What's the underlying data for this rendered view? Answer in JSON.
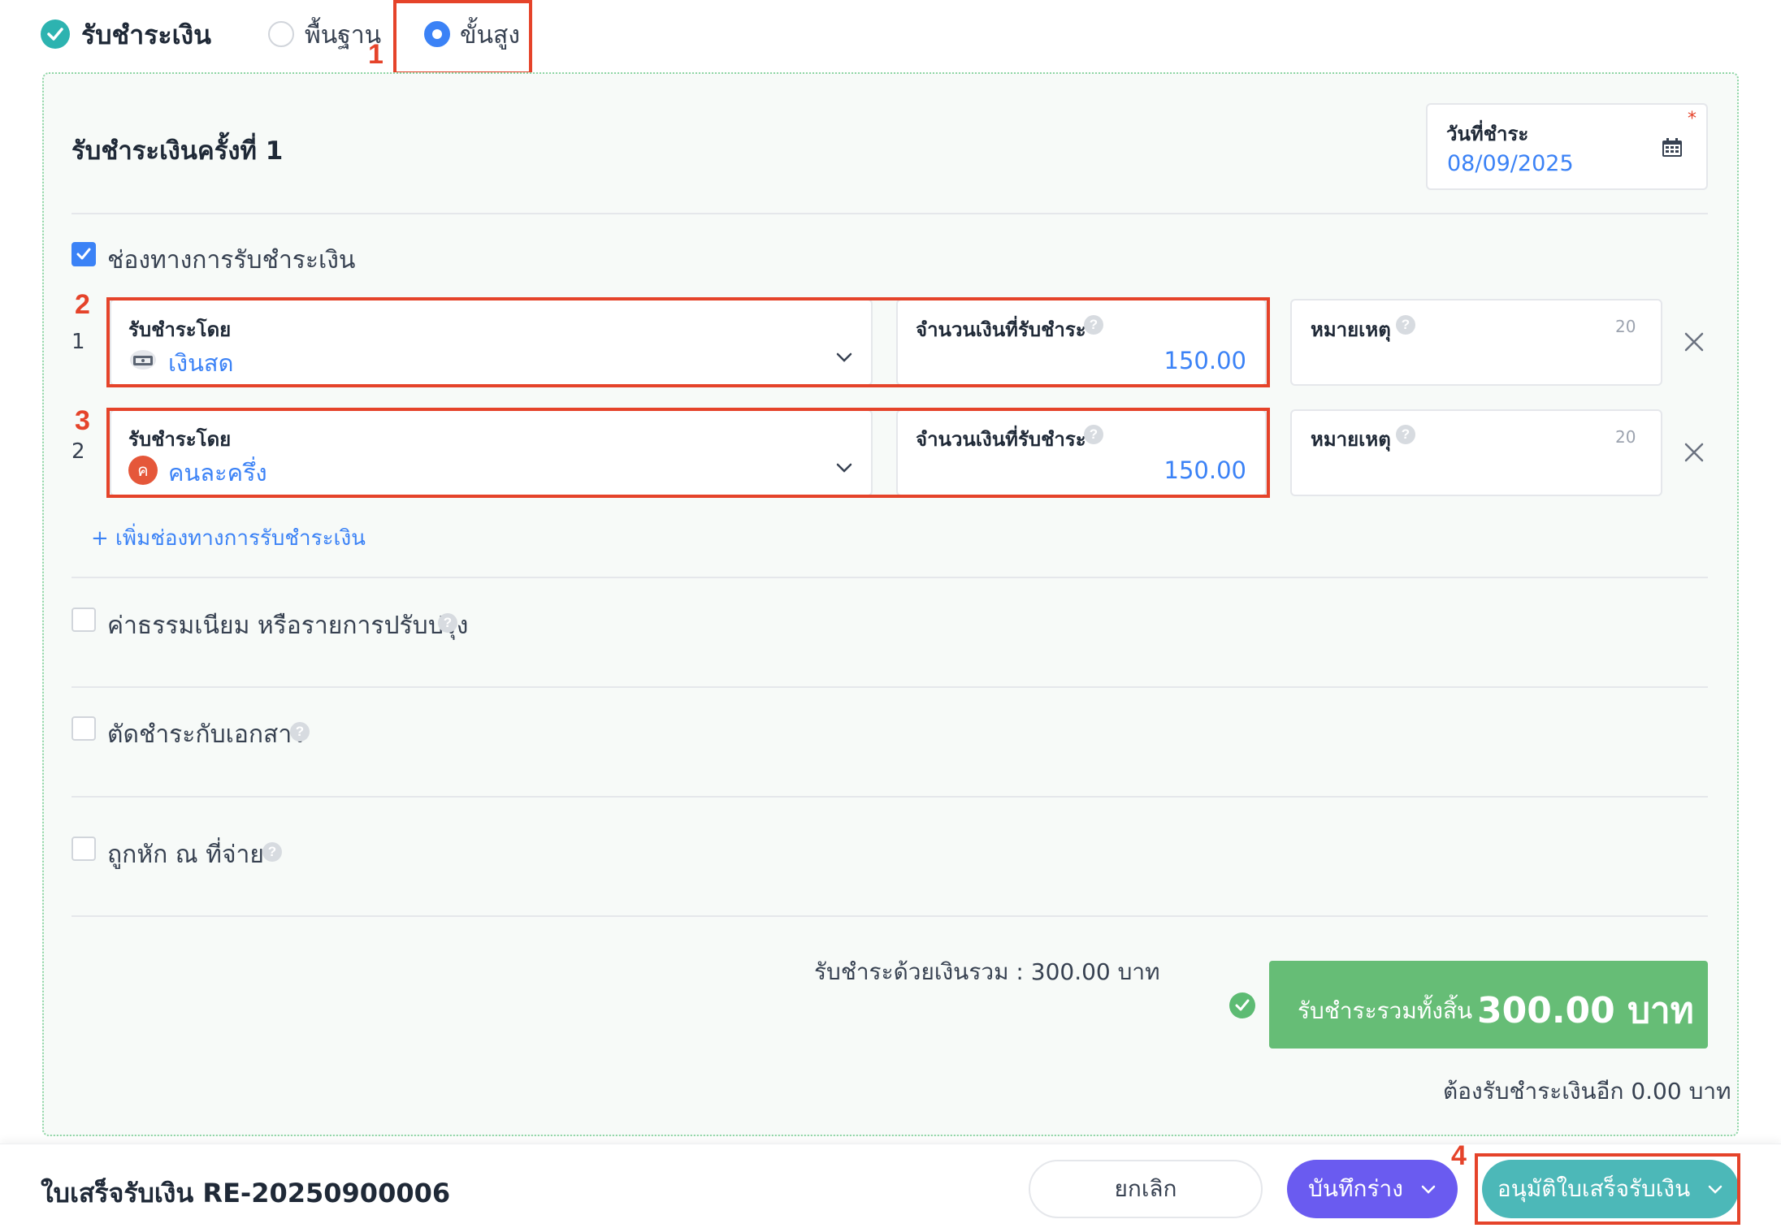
{
  "header": {
    "title": "รับชำระเงิน",
    "mode_options": [
      {
        "label": "พื้นฐาน",
        "selected": false
      },
      {
        "label": "ขั้นสูง",
        "selected": true
      }
    ]
  },
  "annotations": [
    "1",
    "2",
    "3",
    "4"
  ],
  "payment": {
    "section_title": "รับชำระเงินครั้งที่ 1",
    "date_label": "วันที่ชำระ",
    "required_mark": "*",
    "date_value": "08/09/2025",
    "channels_label": "ช่องทางการรับชำระเงิน",
    "channels_checked": true,
    "rows": [
      {
        "index": "1",
        "method_label": "รับชำระโดย",
        "method_value": "เงินสด",
        "method_icon": "cash-icon",
        "amount_label": "จำนวนเงินที่รับชำระ",
        "amount_value": "150.00",
        "note_label": "หมายเหตุ",
        "note_counter": "20"
      },
      {
        "index": "2",
        "method_label": "รับชำระโดย",
        "method_value": "คนละครึ่ง",
        "method_icon_letter": "ค",
        "amount_label": "จำนวนเงินที่รับชำระ",
        "amount_value": "150.00",
        "note_label": "หมายเหตุ",
        "note_counter": "20"
      }
    ],
    "add_channel": "+ เพิ่มช่องทางการรับชำระเงิน",
    "options": [
      {
        "label": "ค่าธรรมเนียม หรือรายการปรับปรุง",
        "checked": false
      },
      {
        "label": "ตัดชำระกับเอกสาร",
        "checked": false
      },
      {
        "label": "ถูกหัก ณ ที่จ่าย",
        "checked": false
      }
    ],
    "help_glyph": "?",
    "sum_text": "รับชำระด้วยเงินรวม :  300.00 บาท",
    "total_label": "รับชำระรวมทั้งสิ้น",
    "total_value": "300.00 บาท",
    "remaining_text": "ต้องรับชำระเงินอีก 0.00 บาท"
  },
  "footer": {
    "document_title": "ใบเสร็จรับเงิน RE-20250900006",
    "cancel_label": "ยกเลิก",
    "draft_label": "บันทึกร่าง",
    "approve_label": "อนุมัติใบเสร็จรับเงิน"
  },
  "colors": {
    "accent_blue": "#3b82f6",
    "annotation_red": "#e5432a",
    "total_green": "#66bd76",
    "draft_purple": "#6a5bf0",
    "approve_teal": "#4cb8b8"
  }
}
